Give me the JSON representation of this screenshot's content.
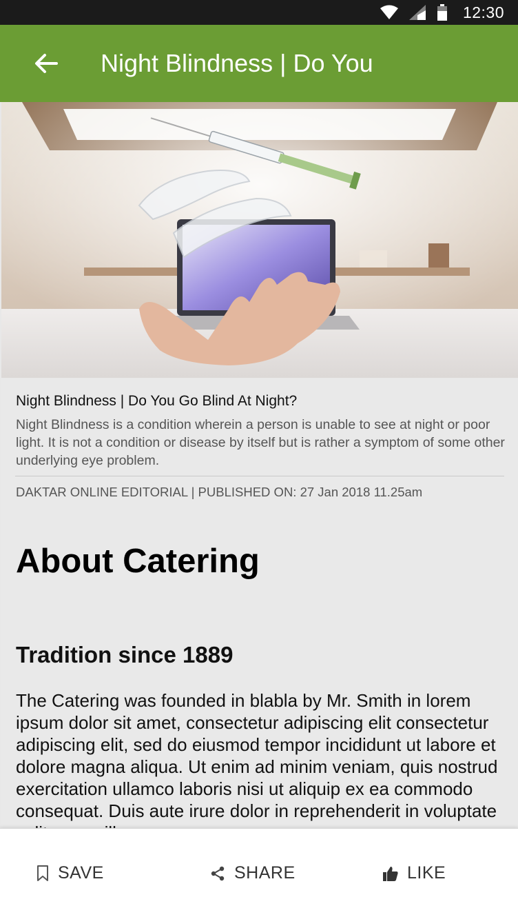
{
  "status_bar": {
    "time": "12:30"
  },
  "app_bar": {
    "title": "Night Blindness | Do You",
    "back_icon": "arrow-back-icon"
  },
  "hero": {
    "image": "hand-with-aligners-and-syringe-photo"
  },
  "article": {
    "title": "Night Blindness | Do You Go Blind At Night?",
    "summary": "Night Blindness is a condition wherein a person is unable to see at night or poor light. It is not a condition or disease by itself but is rather a symptom of some other underlying eye problem.",
    "meta": "DAKTAR ONLINE EDITORIAL | PUBLISHED ON: 27 Jan 2018 11.25am",
    "heading": "About Catering",
    "subheading": "Tradition since 1889",
    "body": "The Catering was founded in blabla by Mr. Smith in lorem ipsum dolor sit amet, consectetur adipiscing elit consectetur adipiscing elit, sed do eiusmod tempor incididunt ut labore et dolore magna aliqua. Ut enim ad minim veniam, quis nostrud exercitation ullamco laboris nisi ut aliquip ex ea commodo consequat. Duis aute irure dolor in reprehenderit in voluptate velit esse cillum"
  },
  "actions": {
    "save_label": "SAVE",
    "share_label": "SHARE",
    "like_label": "LIKE"
  },
  "colors": {
    "app_bar": "#6b9d34",
    "status_bar": "#1b1b1b",
    "content_bg": "#e9e9e9"
  }
}
